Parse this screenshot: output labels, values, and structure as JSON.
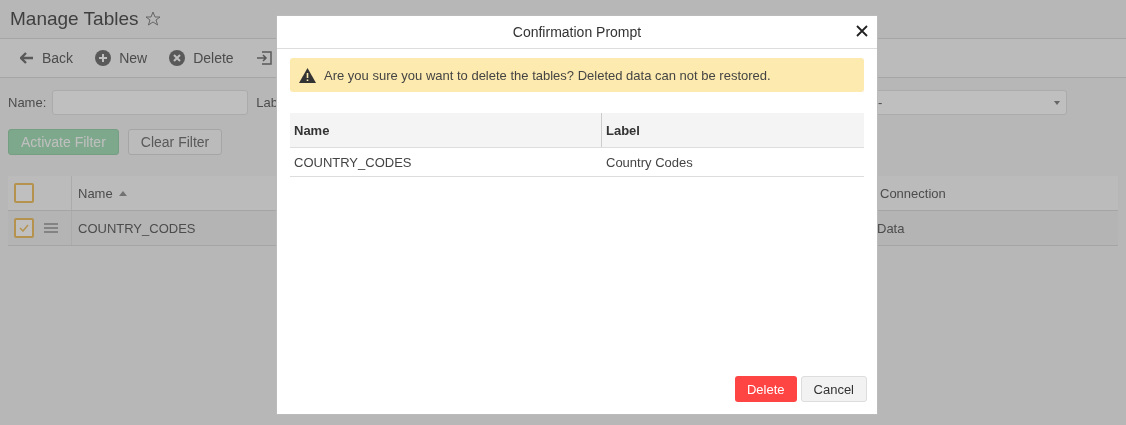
{
  "page": {
    "title": "Manage Tables"
  },
  "toolbar": [
    {
      "kind": "back",
      "label": "Back"
    },
    {
      "kind": "new",
      "label": "New"
    },
    {
      "kind": "delete",
      "label": "Delete"
    },
    {
      "kind": "import"
    }
  ],
  "filters": {
    "name_label": "Name:",
    "label_label": "Lab",
    "select_value": "-"
  },
  "filter_buttons": [
    {
      "kind": "primary",
      "label": "Activate Filter"
    },
    {
      "kind": "default",
      "label": "Clear Filter"
    }
  ],
  "table": {
    "all_checked": false,
    "columns": [
      {
        "label": "Name",
        "sorted": true
      },
      {
        "label": "Connection",
        "sorted": false
      }
    ],
    "rows": [
      {
        "checked": true,
        "name": "COUNTRY_CODES",
        "connection": "Data"
      }
    ]
  },
  "dialog": {
    "title": "Confirmation Prompt",
    "message": "Are you sure you want to delete the tables? Deleted data can not be restored.",
    "columns": [
      "Name",
      "Label"
    ],
    "rows": [
      {
        "name": "COUNTRY_CODES",
        "label": "Country Codes"
      }
    ],
    "buttons": [
      {
        "kind": "danger",
        "label": "Delete"
      },
      {
        "kind": "default",
        "label": "Cancel"
      }
    ]
  }
}
